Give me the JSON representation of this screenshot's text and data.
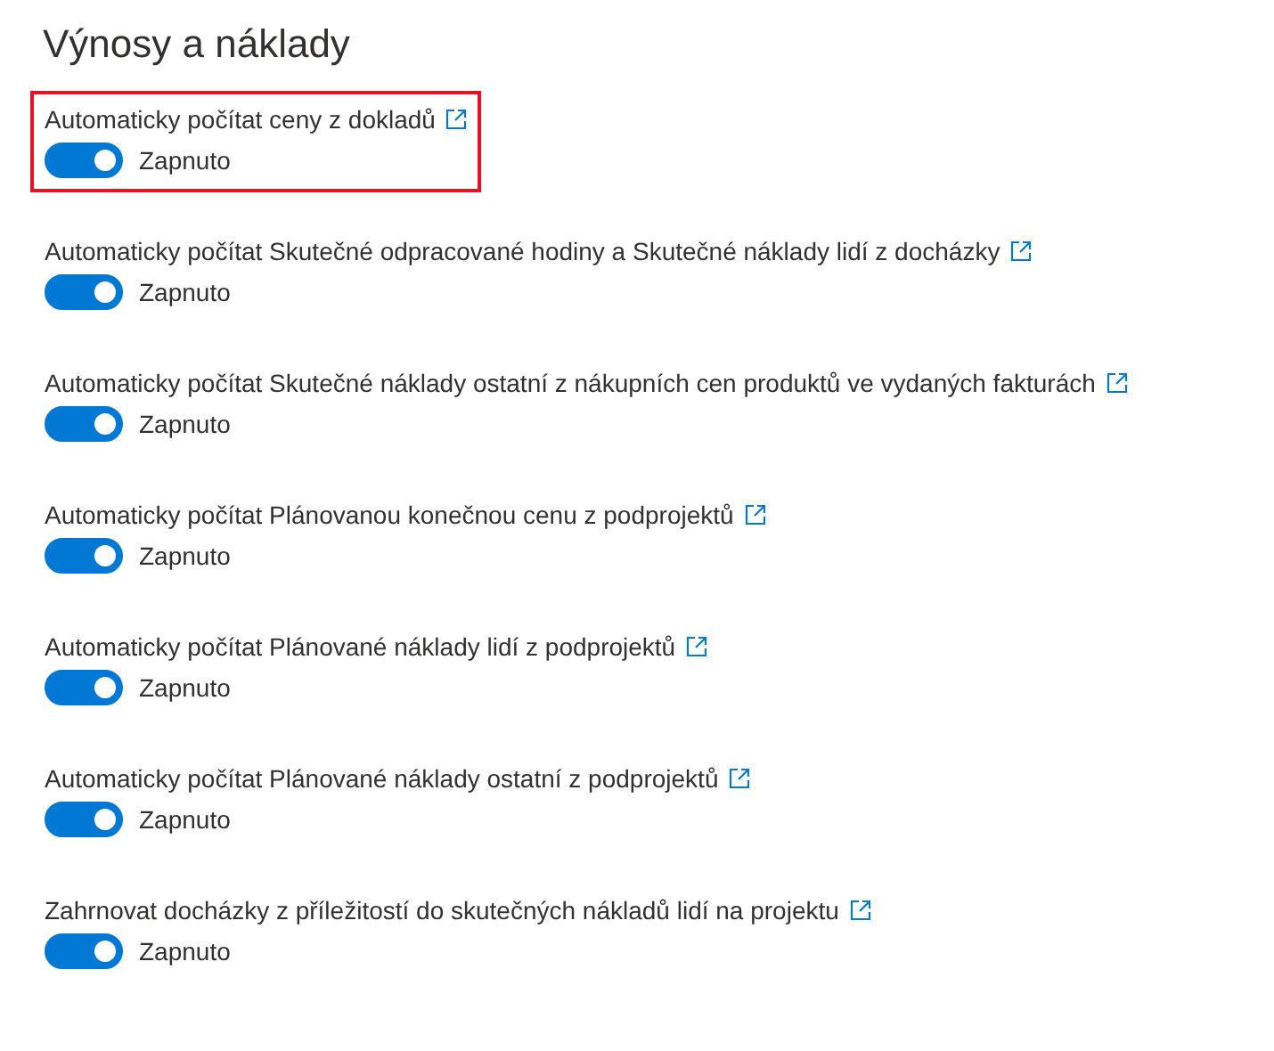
{
  "title": "Výnosy a náklady",
  "settings": [
    {
      "label": "Automaticky počítat ceny z dokladů",
      "on": true,
      "state_text": "Zapnuto",
      "highlighted": true
    },
    {
      "label": "Automaticky počítat Skutečné odpracované hodiny a Skutečné náklady lidí z docházky",
      "on": true,
      "state_text": "Zapnuto",
      "highlighted": false
    },
    {
      "label": "Automaticky počítat Skutečné náklady ostatní z nákupních cen produktů ve vydaných fakturách",
      "on": true,
      "state_text": "Zapnuto",
      "highlighted": false
    },
    {
      "label": "Automaticky počítat Plánovanou konečnou cenu z podprojektů",
      "on": true,
      "state_text": "Zapnuto",
      "highlighted": false
    },
    {
      "label": "Automaticky počítat Plánované náklady lidí z podprojektů",
      "on": true,
      "state_text": "Zapnuto",
      "highlighted": false
    },
    {
      "label": "Automaticky počítat Plánované náklady ostatní z podprojektů",
      "on": true,
      "state_text": "Zapnuto",
      "highlighted": false
    },
    {
      "label": "Zahrnovat docházky z příležitostí do skutečných nákladů lidí na projektu",
      "on": true,
      "state_text": "Zapnuto",
      "highlighted": false
    }
  ]
}
